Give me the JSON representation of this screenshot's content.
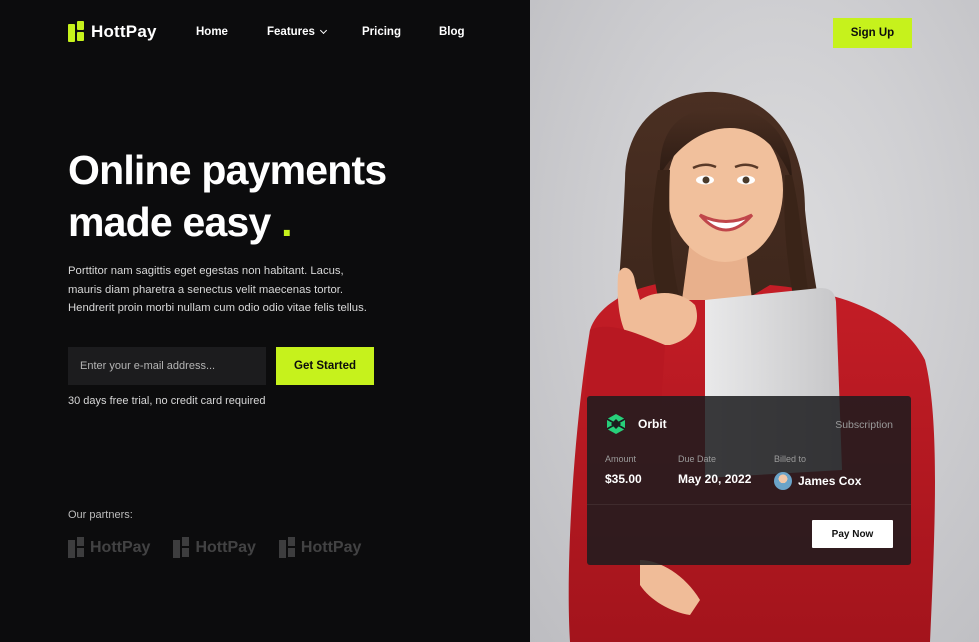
{
  "brand": {
    "name": "HottPay",
    "accent": "#c6f21c"
  },
  "nav": {
    "home": "Home",
    "features": "Features",
    "pricing": "Pricing",
    "blog": "Blog",
    "signup": "Sign Up"
  },
  "hero": {
    "headline_line1": "Online payments",
    "headline_line2": "made easy",
    "headline_dot": ".",
    "description": "Porttitor nam sagittis eget egestas non habitant. Lacus, mauris diam pharetra a senectus velit maecenas tortor. Hendrerit proin morbi nullam cum odio odio vitae felis tellus.",
    "email_placeholder": "Enter your e-mail address...",
    "cta": "Get Started",
    "trial_note": "30 days free trial, no credit card required"
  },
  "partners": {
    "label": "Our partners:",
    "logos": [
      "HottPay",
      "HottPay",
      "HottPay"
    ]
  },
  "card": {
    "company": "Orbit",
    "type": "Subscription",
    "amount_label": "Amount",
    "amount": "$35.00",
    "due_label": "Due Date",
    "due": "May 20, 2022",
    "billed_label": "Billed to",
    "billed": "James Cox",
    "pay_button": "Pay Now",
    "icon_color": "#27d07a"
  }
}
